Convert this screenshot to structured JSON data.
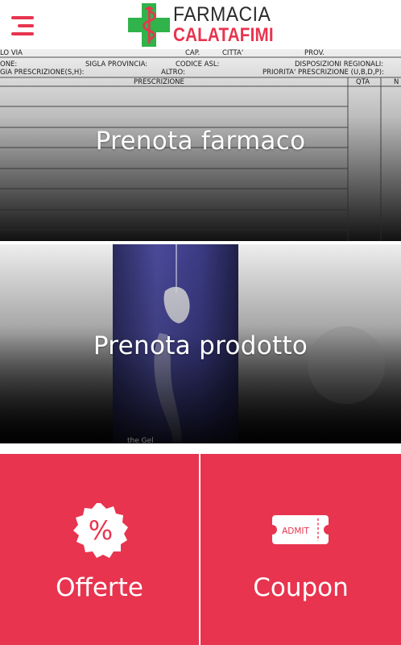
{
  "header": {
    "menu_icon": "hamburger-menu-icon",
    "logo": {
      "line1": "FARMACIA",
      "line2": "CALATAFIMI",
      "cross_color": "#2fb34a",
      "caduceus_color": "#e8344f"
    }
  },
  "banners": [
    {
      "label": "Prenota farmaco",
      "image": "prescription-form-image",
      "form_text": {
        "row1": [
          "LO VIA",
          "CAP.",
          "CITTA'",
          "PROV."
        ],
        "row2": [
          "ONE:",
          "SIGLA PROVINCIA:",
          "CODICE ASL:",
          "DISPOSIZIONI REGIONALI:"
        ],
        "row3": [
          "GIA PRESCRIZIONE(S,H):",
          "ALTRO:",
          "PRIORITA' PRESCRIZIONE (U,B,D,P):"
        ],
        "header": [
          "PRESCRIZIONE",
          "QTA",
          "N"
        ]
      }
    },
    {
      "label": "Prenota prodotto",
      "image": "product-bottle-image",
      "caption": "the Gel"
    }
  ],
  "tiles": [
    {
      "label": "Offerte",
      "icon": "percent-badge-icon",
      "icon_text": "%"
    },
    {
      "label": "Coupon",
      "icon": "admit-ticket-icon",
      "icon_text": "ADMIT"
    }
  ],
  "colors": {
    "accent": "#e8344f",
    "tile_text": "#ffffff",
    "logo_dark": "#2b2b2b"
  }
}
